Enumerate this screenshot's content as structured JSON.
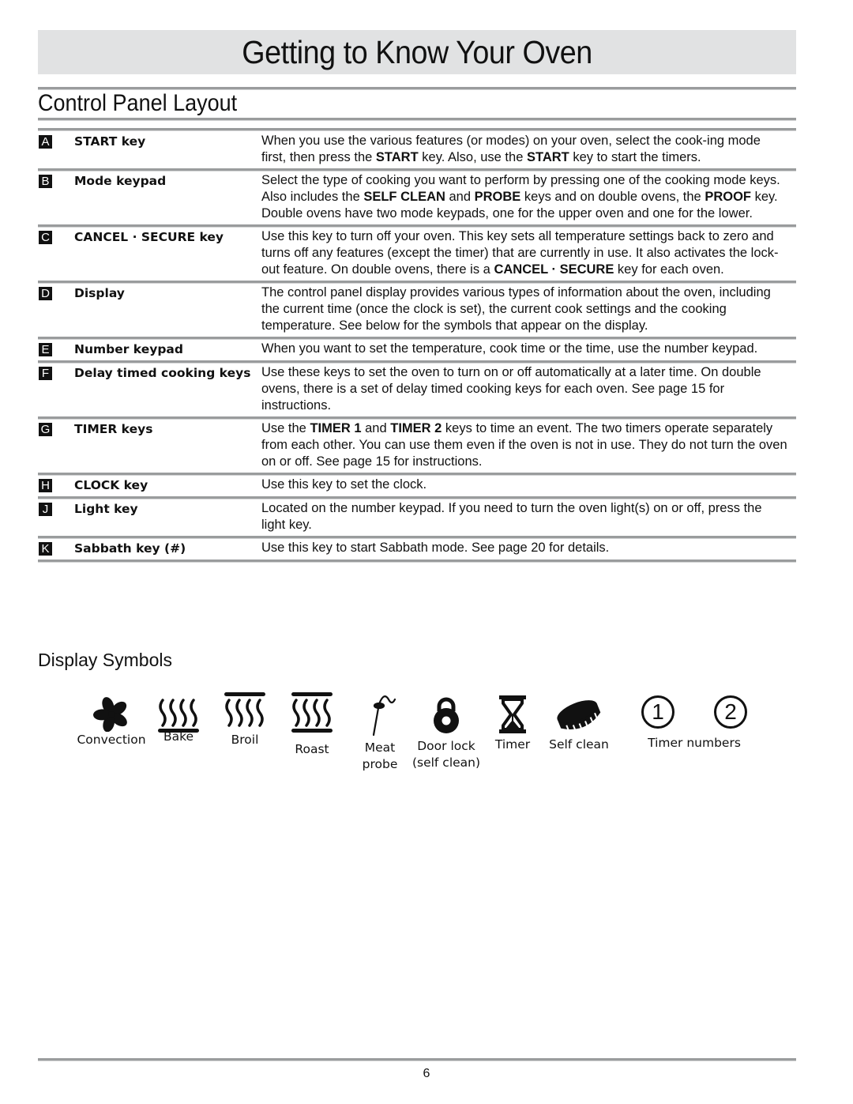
{
  "page_title": "Getting to Know Your Oven",
  "section_title": "Control Panel Layout",
  "items": [
    {
      "letter": "A",
      "term": "START key",
      "desc": [
        {
          "t": "When you use the various features (or modes) on your oven, select the cook-\ning mode first, then press the "
        },
        {
          "b": "START"
        },
        {
          "t": " key. Also, use the "
        },
        {
          "b": "START"
        },
        {
          "t": " key to start the timers."
        }
      ]
    },
    {
      "letter": "B",
      "term": "Mode keypad",
      "desc": [
        {
          "t": "Select the type of cooking you want to perform by pressing one of the cooking mode keys. Also includes the "
        },
        {
          "b": "SELF CLEAN"
        },
        {
          "t": " and "
        },
        {
          "b": "PROBE"
        },
        {
          "t": " keys and on double ovens, the "
        },
        {
          "b": "PROOF"
        },
        {
          "t": " key. Double ovens have two mode keypads, one for the upper oven and one for the lower."
        }
      ]
    },
    {
      "letter": "C",
      "term": "CANCEL · SECURE key",
      "desc": [
        {
          "t": "Use this key to turn off your oven. This key sets all temperature settings back to zero and turns off any features (except the timer) that are currently in use. It also activates the lock-out feature. On double ovens, there is a "
        },
        {
          "b": "CANCEL · SECURE"
        },
        {
          "t": " key for each oven."
        }
      ]
    },
    {
      "letter": "D",
      "term": "Display",
      "desc": [
        {
          "t": "The control panel display provides various types of information about the oven, including the current time (once the clock is set), the current cook settings and the cooking temperature. See below for the symbols that appear on the display."
        }
      ]
    },
    {
      "letter": "E",
      "term": "Number keypad",
      "desc": [
        {
          "t": "When you want to set the temperature, cook time or the time, use the number keypad."
        }
      ]
    },
    {
      "letter": "F",
      "term": "Delay timed cooking keys",
      "desc": [
        {
          "t": "Use these keys to set the oven to turn on or off automatically at a later time. On double ovens, there is a set of delay timed cooking keys for each oven. See page 15 for instructions."
        }
      ]
    },
    {
      "letter": "G",
      "term": "TIMER keys",
      "desc": [
        {
          "t": "Use the "
        },
        {
          "b": "TIMER 1"
        },
        {
          "t": " and "
        },
        {
          "b": "TIMER 2"
        },
        {
          "t": " keys to time an event. The two timers operate separately from each other. You can use them even if the oven is not in use. They do not turn the oven on or off. See page 15 for instructions."
        }
      ]
    },
    {
      "letter": "H",
      "term": "CLOCK key",
      "desc": [
        {
          "t": "Use this key to set the clock."
        }
      ]
    },
    {
      "letter": "J",
      "term": "Light key",
      "desc": [
        {
          "t": "Located on the number keypad. If you need to turn the oven light(s) on or off, press the light key."
        }
      ]
    },
    {
      "letter": "K",
      "term": "Sabbath key (#)",
      "desc": [
        {
          "t": "Use this key to start Sabbath mode. See page 20 for details."
        }
      ]
    }
  ],
  "display_symbols": {
    "title": "Display Symbols",
    "symbols": [
      {
        "icon": "convection-fan-icon",
        "label": "Convection"
      },
      {
        "icon": "bake-icon",
        "label": "Bake"
      },
      {
        "icon": "broil-icon",
        "label": "Broil"
      },
      {
        "icon": "roast-icon",
        "label": "Roast"
      },
      {
        "icon": "meat-probe-icon",
        "label": "Meat probe"
      },
      {
        "icon": "door-lock-icon",
        "label": "Door lock (self clean)"
      },
      {
        "icon": "hourglass-timer-icon",
        "label": "Timer"
      },
      {
        "icon": "self-clean-icon",
        "label": "Self clean"
      },
      {
        "icon": "timer-number-icons",
        "label": "Timer numbers",
        "numbers": [
          "1",
          "2"
        ]
      }
    ]
  },
  "page_number": "6"
}
